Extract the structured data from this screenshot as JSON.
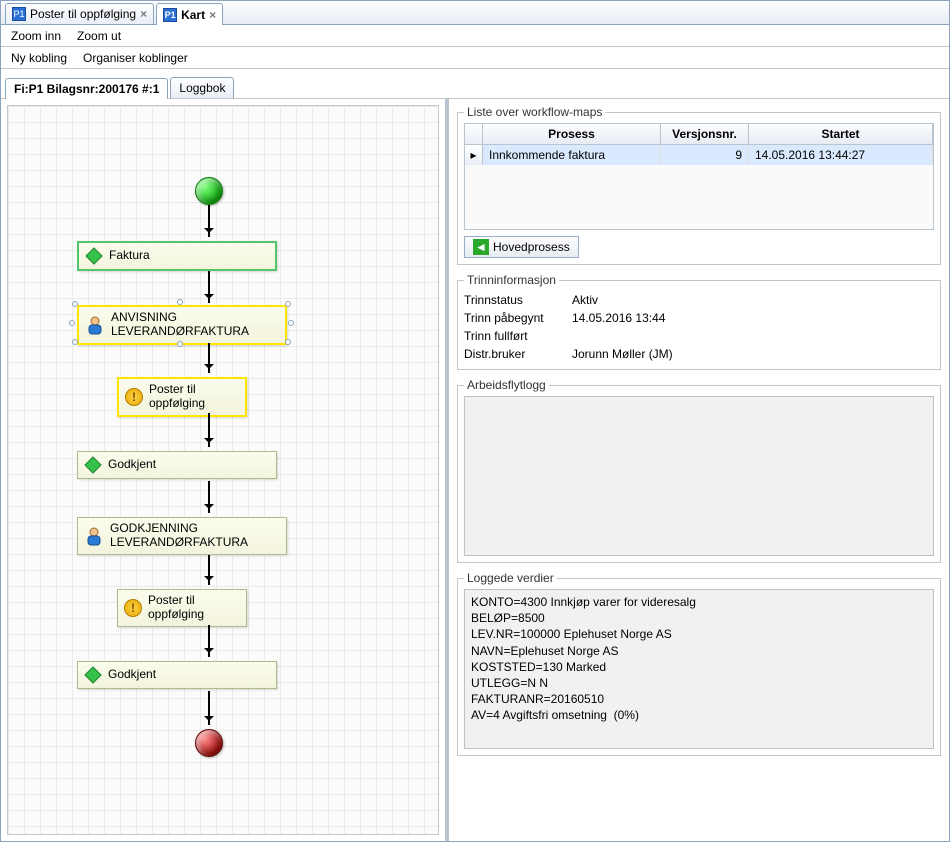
{
  "tabs": [
    {
      "label": "Poster til oppfølging",
      "active": false
    },
    {
      "label": "Kart",
      "active": true
    }
  ],
  "menu1": {
    "zoom_in": "Zoom inn",
    "zoom_out": "Zoom ut"
  },
  "menu2": {
    "ny_kobling": "Ny kobling",
    "organiser": "Organiser koblinger"
  },
  "sub_tabs": {
    "main": "Fi:P1 Bilagsnr:200176 #:1",
    "loggbok": "Loggbok"
  },
  "flow": {
    "start": "start",
    "end": "end",
    "nodes": [
      {
        "id": "faktura",
        "label": "Faktura",
        "icon": "diamond",
        "border": "green"
      },
      {
        "id": "anvisning",
        "label": "ANVISNING\nLEVERANDØRFAKTURA",
        "icon": "person",
        "border": "yellow",
        "selected": true
      },
      {
        "id": "oppf1",
        "label": "Poster til\noppfølging",
        "icon": "warn",
        "border": "yellow"
      },
      {
        "id": "godkjent1",
        "label": "Godkjent",
        "icon": "diamond",
        "border": ""
      },
      {
        "id": "godkjenning",
        "label": "GODKJENNING\nLEVERANDØRFAKTURA",
        "icon": "person",
        "border": ""
      },
      {
        "id": "oppf2",
        "label": "Poster til\noppfølging",
        "icon": "warn",
        "border": ""
      },
      {
        "id": "godkjent2",
        "label": "Godkjent",
        "icon": "diamond",
        "border": ""
      }
    ]
  },
  "workflow_list": {
    "legend": "Liste over workflow-maps",
    "headers": {
      "process": "Prosess",
      "version": "Versjonsnr.",
      "started": "Startet"
    },
    "row": {
      "process": "Innkommende faktura",
      "version": "9",
      "started": "14.05.2016 13:44:27"
    }
  },
  "hovedprosess_btn": "Hovedprosess",
  "step_info": {
    "legend": "Trinninformasjon",
    "status_k": "Trinnstatus",
    "status_v": "Aktiv",
    "begun_k": "Trinn påbegynt",
    "begun_v": "14.05.2016 13:44",
    "done_k": "Trinn fullført",
    "done_v": "",
    "user_k": "Distr.bruker",
    "user_v": "Jorunn Møller (JM)"
  },
  "worklog_legend": "Arbeidsflytlogg",
  "logged_values": {
    "legend": "Loggede verdier",
    "text": "KONTO=4300 Innkjøp varer for videresalg\nBELØP=8500\nLEV.NR=100000 Eplehuset Norge AS\nNAVN=Eplehuset Norge AS\nKOSTSTED=130 Marked\nUTLEGG=N N\nFAKTURANR=20160510\nAV=4 Avgiftsfri omsetning  (0%)"
  }
}
